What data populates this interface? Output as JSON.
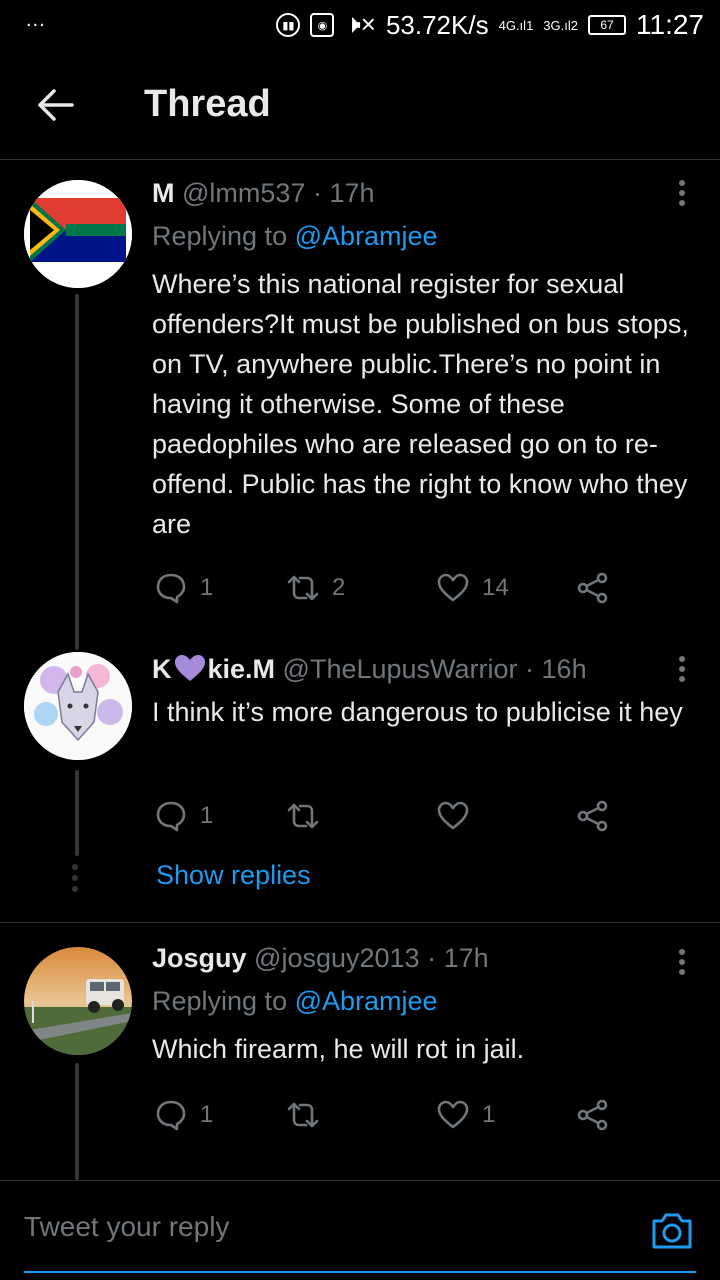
{
  "status_bar": {
    "left": "...",
    "speed": "53.72K/s",
    "net1": "4G",
    "sim1": "1",
    "net2": "3G",
    "sim2": "2",
    "battery": "67",
    "time": "11:27"
  },
  "header": {
    "title": "Thread",
    "back_icon": "back-arrow-icon"
  },
  "tweets": [
    {
      "name": "M",
      "handle": "@lmm537",
      "time": "· 17h",
      "replying_prefix": "Replying to",
      "replying_to": "@Abramjee",
      "text": "Where’s this national register for sexual offenders?It must be published on bus stops, on TV, anywhere public.There’s no point in having it otherwise. Some of these paedophiles who are released go on to re-offend. Public has the right  to know who they are",
      "replies": "1",
      "retweets": "2",
      "likes": "14"
    },
    {
      "name_prefix": "K",
      "name_suffix": "kie.M",
      "handle": "@TheLupusWarrior",
      "time": "· 16h",
      "text": "I think it’s more dangerous to publicise it hey",
      "replies": "1",
      "retweets": "",
      "likes": ""
    },
    {
      "name": "Josguy",
      "handle": "@josguy2013",
      "time": "· 17h",
      "replying_prefix": "Replying to",
      "replying_to": "@Abramjee",
      "text": "Which firearm, he will rot in jail.",
      "replies": "1",
      "retweets": "",
      "likes": "1"
    }
  ],
  "show_replies": "Show replies",
  "reply_bar": {
    "placeholder": "Tweet your reply"
  },
  "colors": {
    "accent": "#1d9bf0",
    "muted": "#71767b",
    "background": "#000000",
    "heart": "#a78bda"
  }
}
